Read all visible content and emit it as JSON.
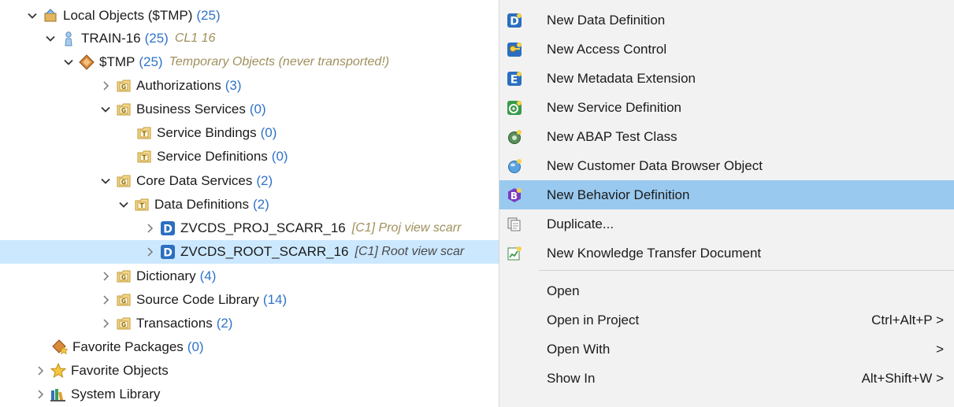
{
  "tree": {
    "rows": [
      {
        "label": "Local Objects ($TMP)",
        "count": "(25)",
        "icon": "local-objects-icon",
        "twisty": "expanded"
      },
      {
        "label": "TRAIN-16",
        "count": "(25)",
        "decoration": "CL1 16",
        "icon": "user-icon",
        "twisty": "expanded"
      },
      {
        "label": "$TMP",
        "count": "(25)",
        "decoration": "Temporary Objects (never transported!)",
        "icon": "package-icon",
        "twisty": "expanded"
      },
      {
        "label": "Authorizations",
        "count": "(3)",
        "icon": "group-folder-icon",
        "twisty": "collapsed"
      },
      {
        "label": "Business Services",
        "count": "(0)",
        "icon": "group-folder-icon",
        "twisty": "expanded"
      },
      {
        "label": "Service Bindings",
        "count": "(0)",
        "icon": "type-folder-icon",
        "twisty": "none"
      },
      {
        "label": "Service Definitions",
        "count": "(0)",
        "icon": "type-folder-icon",
        "twisty": "none"
      },
      {
        "label": "Core Data Services",
        "count": "(2)",
        "icon": "group-folder-icon",
        "twisty": "expanded"
      },
      {
        "label": "Data Definitions",
        "count": "(2)",
        "icon": "type-folder-icon",
        "twisty": "expanded"
      },
      {
        "label": "ZVCDS_PROJ_SCARR_16",
        "decoration": "[C1] Proj view scarr",
        "icon": "data-definition-icon",
        "twisty": "collapsed"
      },
      {
        "label": "ZVCDS_ROOT_SCARR_16",
        "decoration": "[C1] Root view scar",
        "icon": "data-definition-icon",
        "twisty": "collapsed",
        "selected": true
      },
      {
        "label": "Dictionary",
        "count": "(4)",
        "icon": "group-folder-icon",
        "twisty": "collapsed"
      },
      {
        "label": "Source Code Library",
        "count": "(14)",
        "icon": "group-folder-icon",
        "twisty": "collapsed"
      },
      {
        "label": "Transactions",
        "count": "(2)",
        "icon": "group-folder-icon",
        "twisty": "collapsed"
      },
      {
        "label": "Favorite Packages",
        "count": "(0)",
        "icon": "favorite-packages-icon",
        "twisty": "none"
      },
      {
        "label": "Favorite Objects",
        "icon": "star-icon",
        "twisty": "collapsed"
      },
      {
        "label": "System Library",
        "icon": "library-icon",
        "twisty": "collapsed"
      }
    ]
  },
  "menu": {
    "items": [
      {
        "label": "New Data Definition",
        "icon": "data-definition-icon"
      },
      {
        "label": "New Access Control",
        "icon": "access-control-icon"
      },
      {
        "label": "New Metadata Extension",
        "icon": "metadata-extension-icon"
      },
      {
        "label": "New Service Definition",
        "icon": "service-definition-icon"
      },
      {
        "label": "New ABAP Test Class",
        "icon": "test-class-icon"
      },
      {
        "label": "New Customer Data Browser Object",
        "icon": "data-browser-icon"
      },
      {
        "label": "New Behavior Definition",
        "icon": "behavior-definition-icon",
        "highlighted": true
      },
      {
        "label": "Duplicate...",
        "icon": "duplicate-icon"
      },
      {
        "label": "New Knowledge Transfer Document",
        "icon": "knowledge-transfer-icon"
      },
      {
        "label": "Open"
      },
      {
        "label": "Open in Project",
        "shortcut": "Ctrl+Alt+P",
        "submenu": ">"
      },
      {
        "label": "Open With",
        "submenu": ">"
      },
      {
        "label": "Show In",
        "shortcut": "Alt+Shift+W",
        "submenu": ">"
      }
    ]
  },
  "colors": {
    "count": "#2f73c8",
    "decoration": "#a0905c",
    "selected_row": "#cce8ff",
    "menu_bg": "#f2f2f2",
    "menu_highlight": "#99c9ef"
  }
}
